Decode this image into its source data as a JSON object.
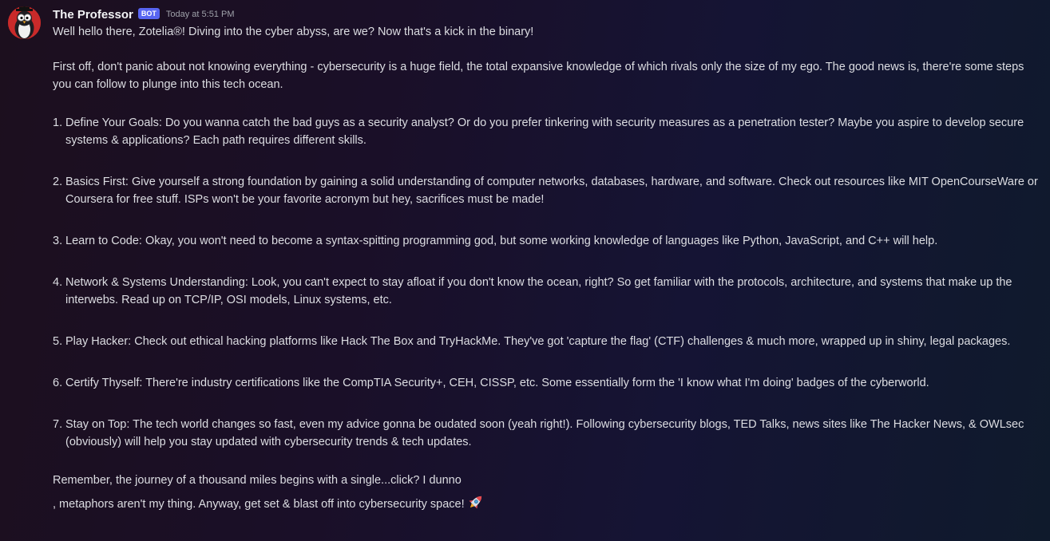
{
  "message": {
    "author": "The Professor",
    "bot_tag": "BOT",
    "timestamp": "Today at 5:51 PM",
    "avatar_icon": "penguin-professor-avatar",
    "intro": "Well hello there, Zotelia®! Diving into the cyber abyss, are we? Now that's a kick in the binary!",
    "paragraph": "First off, don't panic about not knowing everything - cybersecurity is a huge field, the total expansive knowledge of which rivals only the size of my ego. The good news is, there're some steps you can follow to plunge into this tech ocean.",
    "steps": [
      {
        "num": "1.",
        "text": "Define Your Goals: Do you wanna catch the bad guys as a security analyst? Or do you prefer tinkering with security measures as a penetration tester? Maybe you aspire to develop secure systems & applications? Each path requires different skills."
      },
      {
        "num": "2.",
        "text": "Basics First: Give yourself a strong foundation by gaining a solid understanding of computer networks, databases, hardware, and software. Check out resources like MIT OpenCourseWare or Coursera for free stuff. ISPs won't be your favorite acronym but hey, sacrifices must be made!"
      },
      {
        "num": "3.",
        "text": "Learn to Code: Okay, you won't need to become a syntax-spitting programming god, but some working knowledge of languages like Python, JavaScript, and C++ will help."
      },
      {
        "num": "4.",
        "text": "Network & Systems Understanding: Look, you can't expect to stay afloat if you don't know the ocean, right? So get familiar with the protocols, architecture, and systems that make up the interwebs. Read up on TCP/IP, OSI models, Linux systems, etc."
      },
      {
        "num": "5.",
        "text": "Play Hacker: Check out ethical hacking platforms like Hack The Box and TryHackMe. They've got 'capture the flag' (CTF) challenges & much more, wrapped up in shiny, legal packages."
      },
      {
        "num": "6.",
        "text": "Certify Thyself: There're industry certifications like the CompTIA Security+, CEH, CISSP, etc. Some essentially form the 'I know what I'm doing' badges of the cyberworld."
      },
      {
        "num": "7.",
        "text": "Stay on Top: The tech world changes so fast, even my advice gonna be oudated soon (yeah right!). Following cybersecurity blogs, TED Talks, news sites like The Hacker News, & OWLsec (obviously) will help you stay updated with cybersecurity trends & tech updates."
      }
    ],
    "outro_line1": "Remember, the journey of a thousand miles begins with a single...click? I dunno",
    "outro_line2": ", metaphors aren't my thing. Anyway, get set & blast off into cybersecurity space!",
    "outro_emoji": "rocket-emoji"
  },
  "colors": {
    "bot_tag": "#5865f2",
    "username": "#f2f3f5",
    "text": "#dcdde2",
    "timestamp": "#9fa2aa"
  }
}
